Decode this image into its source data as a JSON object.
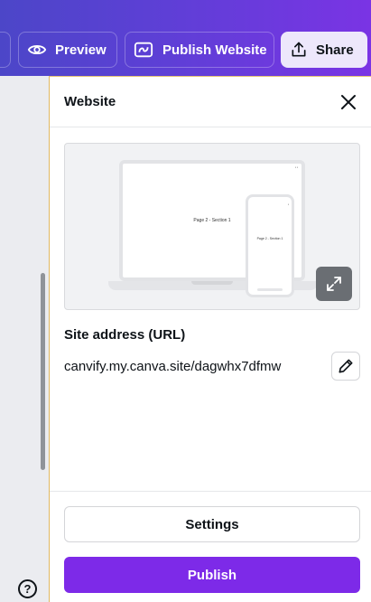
{
  "topbar": {
    "preview_label": "Preview",
    "publish_website_label": "Publish Website",
    "share_label": "Share"
  },
  "panel": {
    "title": "Website",
    "preview": {
      "desktop_page_text": "Page 2 - Section 1",
      "mobile_page_text": "Page 2 - Section 1"
    },
    "site_address_label": "Site address (URL)",
    "site_address_value": "canvify.my.canva.site/dagwhx7dfmw",
    "settings_label": "Settings",
    "publish_label": "Publish"
  },
  "help_label": "?",
  "colors": {
    "accent": "#7d2ae8",
    "topbar_start": "#4c46c8",
    "topbar_end": "#7a34e4"
  }
}
